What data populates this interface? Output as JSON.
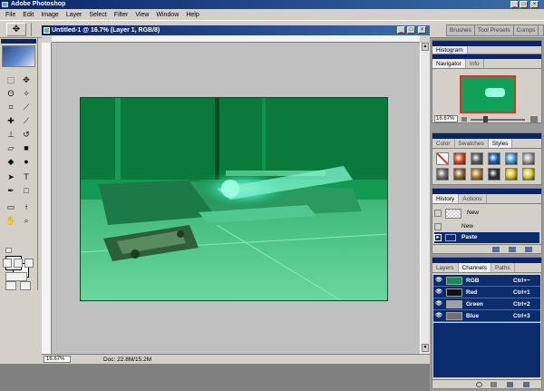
{
  "app": {
    "title": "Adobe Photoshop"
  },
  "window_controls": [
    "_",
    "□",
    "×"
  ],
  "menu": [
    "File",
    "Edit",
    "Image",
    "Layer",
    "Select",
    "Filter",
    "View",
    "Window",
    "Help"
  ],
  "palette_well": {
    "tabs": [
      "Brushes",
      "Tool Presets",
      "Comps"
    ]
  },
  "document": {
    "title": "Untitled-1 @ 16.7% (Layer 1, RGB/8)",
    "zoom": "16.67%",
    "doc_info": "Doc: 22.8M/15.2M"
  },
  "navigator_panel": {
    "tabs": [
      "Histogram",
      "Navigator",
      "Info"
    ],
    "zoom": "16.67%"
  },
  "color_panel": {
    "tabs": [
      "Color",
      "Swatches",
      "Styles"
    ],
    "styles": [
      {
        "icon": "no-style-icon",
        "color": "#ffffff"
      },
      {
        "icon": "style-swatch",
        "color": "#e04a20"
      },
      {
        "icon": "style-swatch",
        "color": "#606060"
      },
      {
        "icon": "style-swatch",
        "color": "#2060b0"
      },
      {
        "icon": "style-swatch",
        "color": "#4a9ad0"
      },
      {
        "icon": "style-swatch",
        "color": "#a0a0a0"
      },
      {
        "icon": "style-swatch",
        "color": "#707070"
      },
      {
        "icon": "style-swatch",
        "color": "#8a6a30"
      },
      {
        "icon": "style-swatch",
        "color": "#b08030"
      },
      {
        "icon": "style-swatch",
        "color": "#303030"
      },
      {
        "icon": "style-swatch",
        "color": "#e0c020"
      },
      {
        "icon": "style-swatch",
        "color": "#d8d030"
      }
    ]
  },
  "history_panel": {
    "tabs": [
      "History",
      "Actions"
    ],
    "snapshot": "New",
    "items": [
      "New",
      "Paste"
    ],
    "active_index": 1
  },
  "channels_panel": {
    "tabs": [
      "Layers",
      "Channels",
      "Paths"
    ],
    "channels": [
      {
        "name": "RGB",
        "shortcut": "Ctrl+~",
        "thumb": "#1a8a50"
      },
      {
        "name": "Red",
        "shortcut": "Ctrl+1",
        "thumb": "#101010"
      },
      {
        "name": "Green",
        "shortcut": "Ctrl+2",
        "thumb": "#a0a0a0"
      },
      {
        "name": "Blue",
        "shortcut": "Ctrl+3",
        "thumb": "#707070"
      }
    ]
  },
  "colors": {
    "title_bar": "#0a246a",
    "photo_green": "#0a8a42",
    "selection_blue": "#0b2d6e"
  }
}
